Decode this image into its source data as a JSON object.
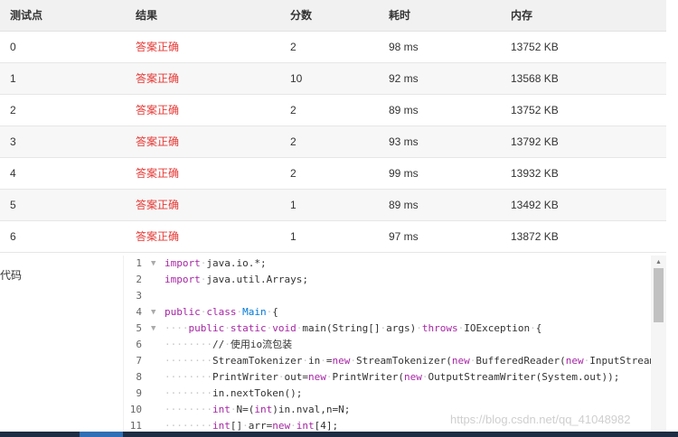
{
  "table": {
    "headers": [
      "测试点",
      "结果",
      "分数",
      "耗时",
      "内存"
    ],
    "rows": [
      {
        "id": "0",
        "result": "答案正确",
        "score": "2",
        "time": "98 ms",
        "memory": "13752 KB"
      },
      {
        "id": "1",
        "result": "答案正确",
        "score": "10",
        "time": "92 ms",
        "memory": "13568 KB"
      },
      {
        "id": "2",
        "result": "答案正确",
        "score": "2",
        "time": "89 ms",
        "memory": "13752 KB"
      },
      {
        "id": "3",
        "result": "答案正确",
        "score": "2",
        "time": "93 ms",
        "memory": "13792 KB"
      },
      {
        "id": "4",
        "result": "答案正确",
        "score": "2",
        "time": "99 ms",
        "memory": "13932 KB"
      },
      {
        "id": "5",
        "result": "答案正确",
        "score": "1",
        "time": "89 ms",
        "memory": "13492 KB"
      },
      {
        "id": "6",
        "result": "答案正确",
        "score": "1",
        "time": "97 ms",
        "memory": "13872 KB"
      }
    ]
  },
  "code_section": {
    "label": "代码",
    "lines": [
      "import java.io.*;",
      "import java.util.Arrays;",
      "",
      "public class Main {",
      "    public static void main(String[] args) throws IOException {",
      "        // 使用io流包装",
      "        StreamTokenizer in =new StreamTokenizer(new BufferedReader(new InputStream",
      "        PrintWriter out=new PrintWriter(new OutputStreamWriter(System.out));",
      "        in.nextToken();",
      "        int N=(int)in.nval,n=N;",
      "        int[] arr=new int[4];"
    ]
  },
  "watermark": "https://blog.csdn.net/qq_41048982",
  "colors": {
    "verdict": "#e53935",
    "keyword": "#a626a4",
    "type": "#0078d7"
  }
}
